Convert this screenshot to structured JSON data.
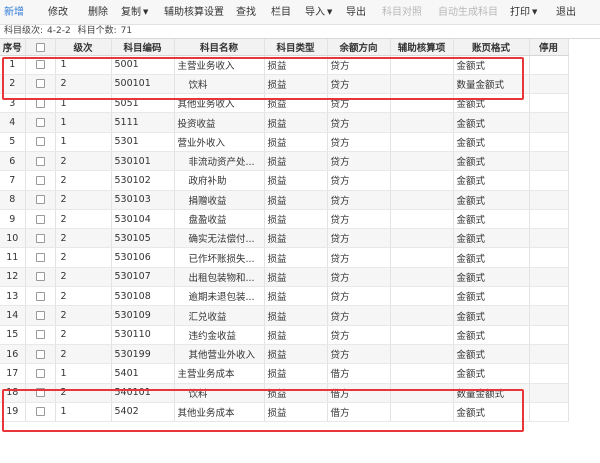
{
  "toolbar": {
    "new": "新增",
    "edit": "修改",
    "delete": "删除",
    "copy": "复制",
    "aux_settings": "辅助核算设置",
    "find": "查找",
    "columns": "栏目",
    "import": "导入",
    "export": "导出",
    "compare": "科目对照",
    "auto_generate": "自动生成科目",
    "print": "打印",
    "exit": "退出"
  },
  "info": {
    "level_label": "科目级次:",
    "level_value": "4-2-2",
    "count_label": "科目个数:",
    "count_value": "71"
  },
  "table": {
    "headers": {
      "seq": "序号",
      "level": "级次",
      "code": "科目编码",
      "name": "科目名称",
      "type": "科目类型",
      "direction": "余额方向",
      "aux": "辅助核算项",
      "format": "账页格式",
      "disabled": "停用"
    },
    "rows": [
      {
        "seq": "1",
        "level": "1",
        "code": "5001",
        "name": "主营业务收入",
        "type": "损益",
        "direction": "贷方",
        "aux": "",
        "format": "金额式",
        "disabled": ""
      },
      {
        "seq": "2",
        "level": "2",
        "code": "500101",
        "name": "饮料",
        "type": "损益",
        "direction": "贷方",
        "aux": "",
        "format": "数量金额式",
        "disabled": ""
      },
      {
        "seq": "3",
        "level": "1",
        "code": "5051",
        "name": "其他业务收入",
        "type": "损益",
        "direction": "贷方",
        "aux": "",
        "format": "金额式",
        "disabled": ""
      },
      {
        "seq": "4",
        "level": "1",
        "code": "5111",
        "name": "投资收益",
        "type": "损益",
        "direction": "贷方",
        "aux": "",
        "format": "金额式",
        "disabled": ""
      },
      {
        "seq": "5",
        "level": "1",
        "code": "5301",
        "name": "营业外收入",
        "type": "损益",
        "direction": "贷方",
        "aux": "",
        "format": "金额式",
        "disabled": ""
      },
      {
        "seq": "6",
        "level": "2",
        "code": "530101",
        "name": "非流动资产处...",
        "type": "损益",
        "direction": "贷方",
        "aux": "",
        "format": "金额式",
        "disabled": ""
      },
      {
        "seq": "7",
        "level": "2",
        "code": "530102",
        "name": "政府补助",
        "type": "损益",
        "direction": "贷方",
        "aux": "",
        "format": "金额式",
        "disabled": ""
      },
      {
        "seq": "8",
        "level": "2",
        "code": "530103",
        "name": "捐赠收益",
        "type": "损益",
        "direction": "贷方",
        "aux": "",
        "format": "金额式",
        "disabled": ""
      },
      {
        "seq": "9",
        "level": "2",
        "code": "530104",
        "name": "盘盈收益",
        "type": "损益",
        "direction": "贷方",
        "aux": "",
        "format": "金额式",
        "disabled": ""
      },
      {
        "seq": "10",
        "level": "2",
        "code": "530105",
        "name": "确实无法偿付...",
        "type": "损益",
        "direction": "贷方",
        "aux": "",
        "format": "金额式",
        "disabled": ""
      },
      {
        "seq": "11",
        "level": "2",
        "code": "530106",
        "name": "已作坏账损失...",
        "type": "损益",
        "direction": "贷方",
        "aux": "",
        "format": "金额式",
        "disabled": ""
      },
      {
        "seq": "12",
        "level": "2",
        "code": "530107",
        "name": "出租包装物和...",
        "type": "损益",
        "direction": "贷方",
        "aux": "",
        "format": "金额式",
        "disabled": ""
      },
      {
        "seq": "13",
        "level": "2",
        "code": "530108",
        "name": "逾期未退包装...",
        "type": "损益",
        "direction": "贷方",
        "aux": "",
        "format": "金额式",
        "disabled": ""
      },
      {
        "seq": "14",
        "level": "2",
        "code": "530109",
        "name": "汇兑收益",
        "type": "损益",
        "direction": "贷方",
        "aux": "",
        "format": "金额式",
        "disabled": ""
      },
      {
        "seq": "15",
        "level": "2",
        "code": "530110",
        "name": "违约金收益",
        "type": "损益",
        "direction": "贷方",
        "aux": "",
        "format": "金额式",
        "disabled": ""
      },
      {
        "seq": "16",
        "level": "2",
        "code": "530199",
        "name": "其他营业外收入",
        "type": "损益",
        "direction": "贷方",
        "aux": "",
        "format": "金额式",
        "disabled": ""
      },
      {
        "seq": "17",
        "level": "1",
        "code": "5401",
        "name": "主营业务成本",
        "type": "损益",
        "direction": "借方",
        "aux": "",
        "format": "金额式",
        "disabled": ""
      },
      {
        "seq": "18",
        "level": "2",
        "code": "540101",
        "name": "饮料",
        "type": "损益",
        "direction": "借方",
        "aux": "",
        "format": "数量金额式",
        "disabled": ""
      },
      {
        "seq": "19",
        "level": "1",
        "code": "5402",
        "name": "其他业务成本",
        "type": "损益",
        "direction": "借方",
        "aux": "",
        "format": "金额式",
        "disabled": ""
      }
    ]
  },
  "colors": {
    "accent": "#2f7bd6",
    "highlight": "#e8353a",
    "disabled_text": "#b8b8b8"
  }
}
